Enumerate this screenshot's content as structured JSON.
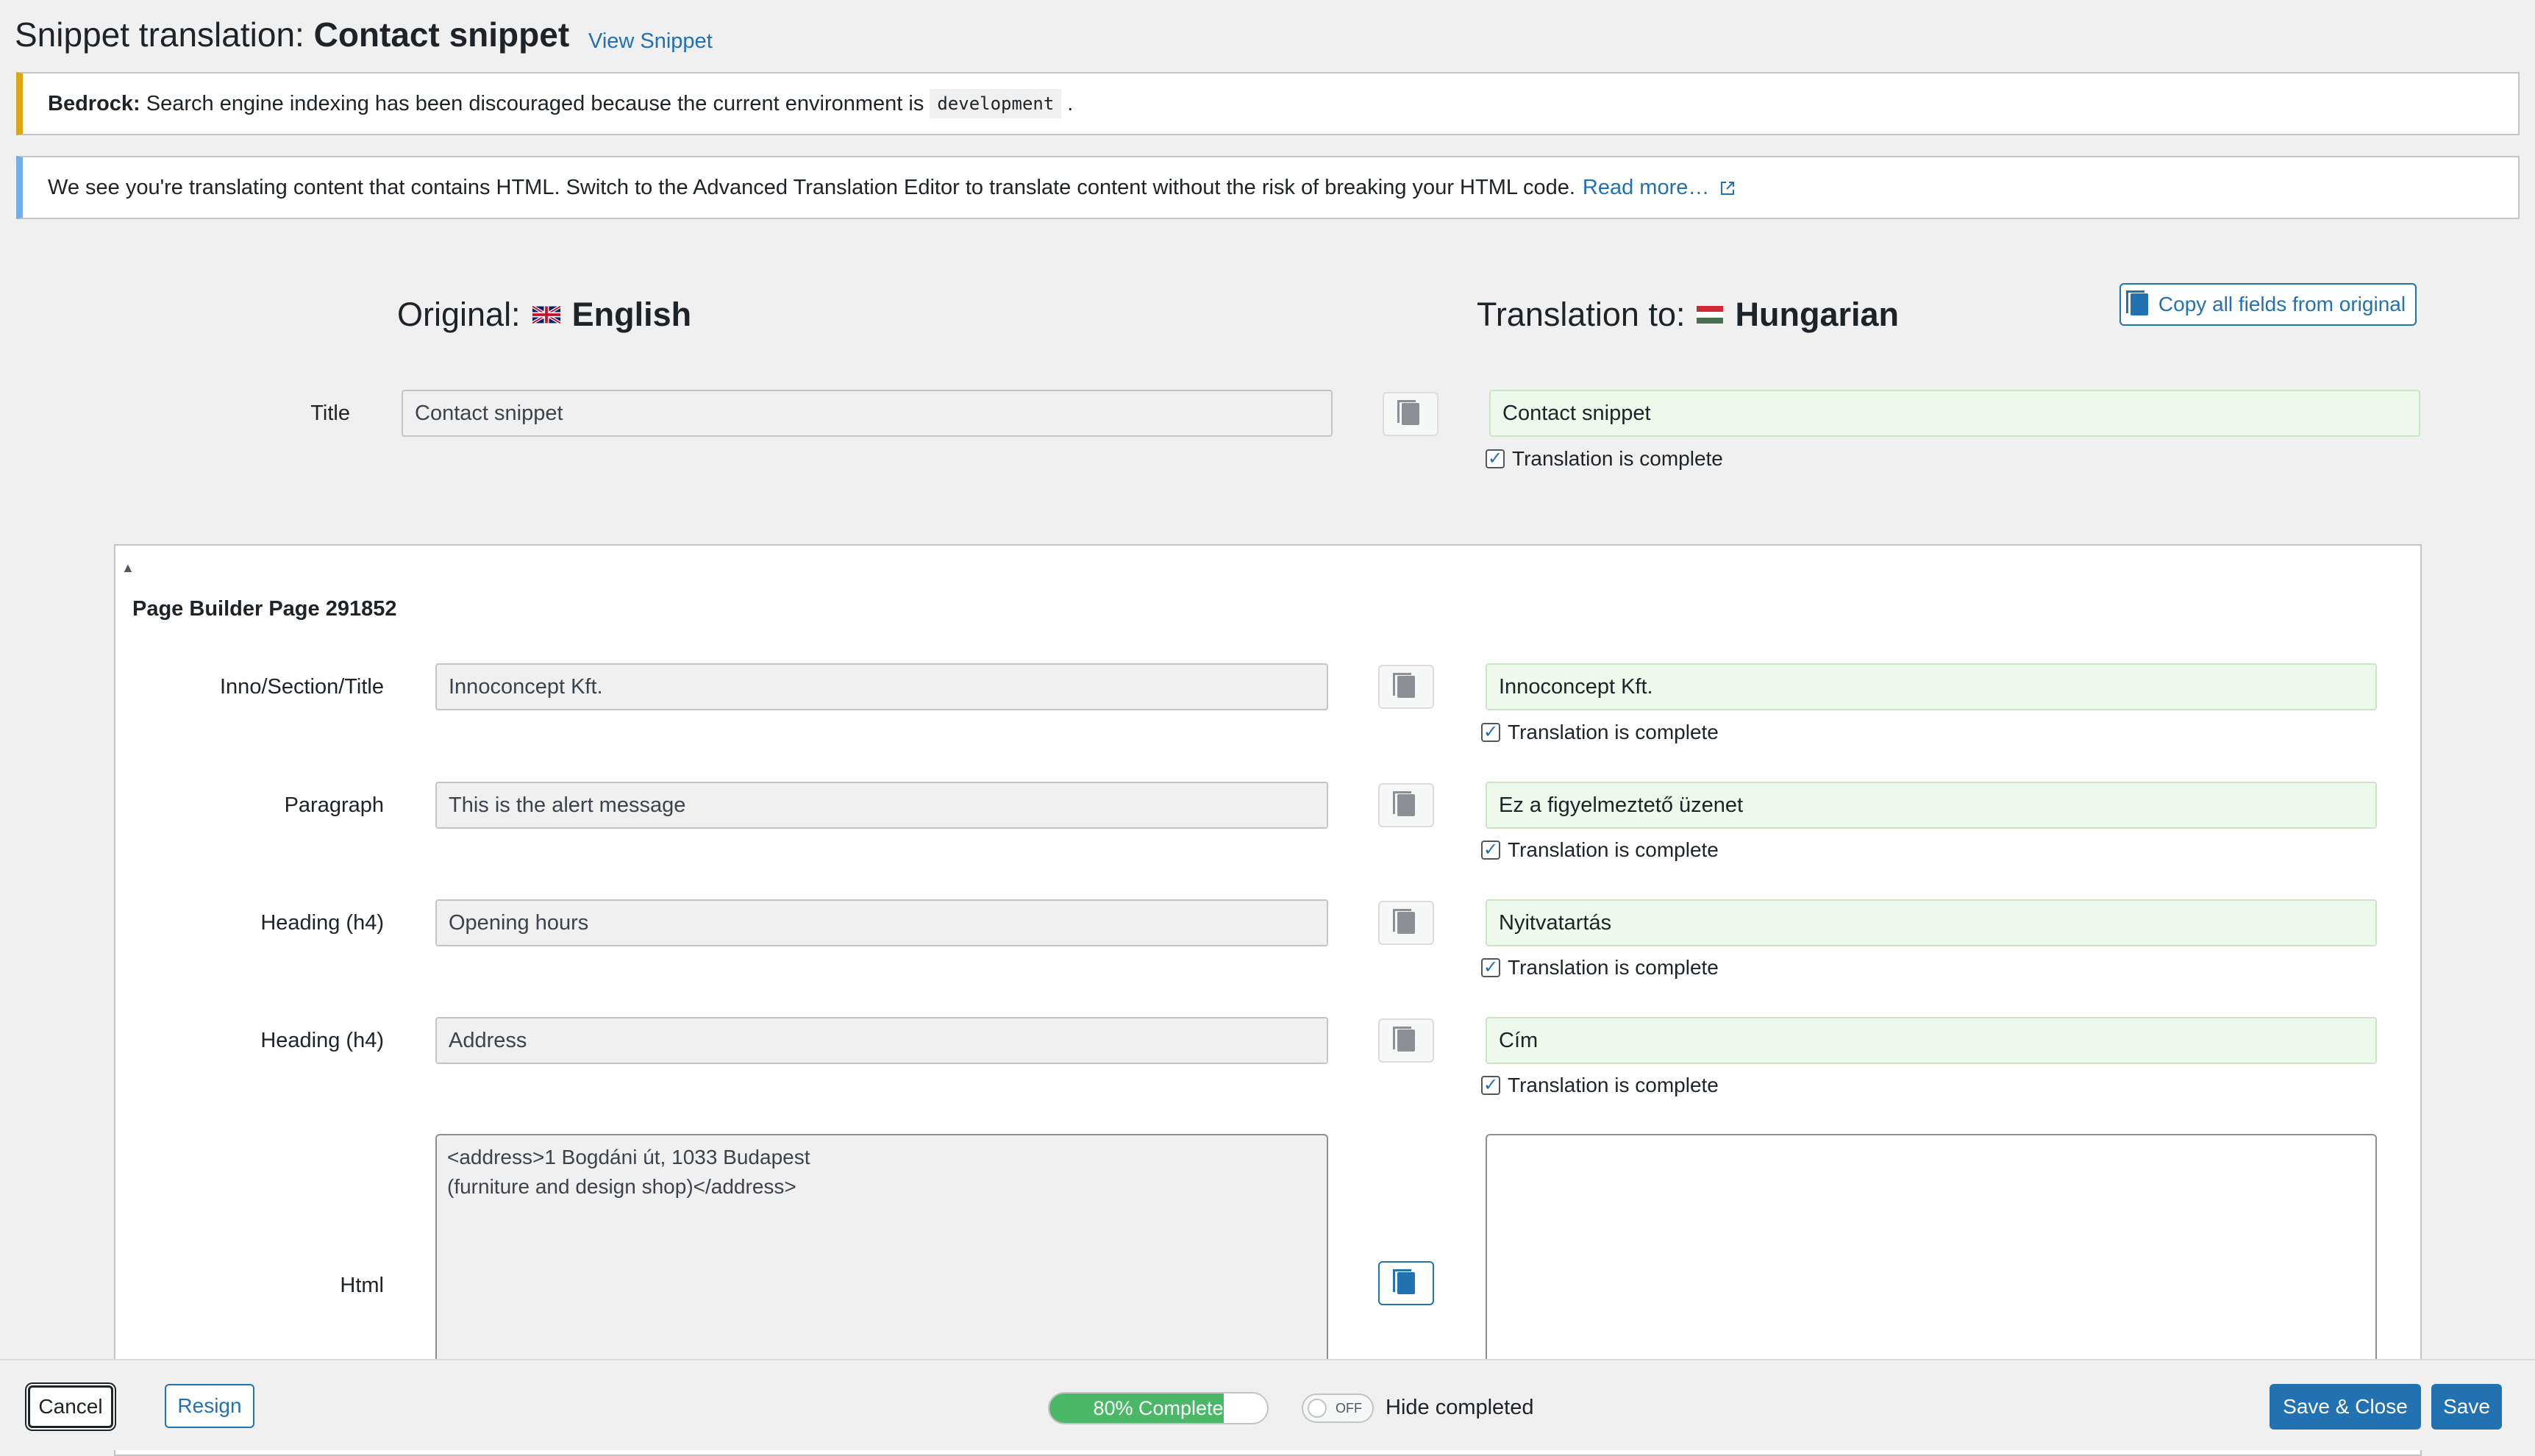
{
  "header": {
    "title_prefix": "Snippet translation: ",
    "title_name": "Contact snippet",
    "view_link": "View Snippet"
  },
  "notices": {
    "bedrock_label": "Bedrock:",
    "bedrock_text": " Search engine indexing has been discouraged because the current environment is",
    "bedrock_code": "development",
    "bedrock_end": ".",
    "html_text": "We see you're translating content that contains HTML. Switch to the Advanced Translation Editor to translate content without the risk of breaking your HTML code.",
    "html_link": "Read more…"
  },
  "columns": {
    "original_label": "Original:",
    "original_lang": "English",
    "translation_label": "Translation to:",
    "translation_lang": "Hungarian",
    "copy_all": "Copy all fields from original"
  },
  "title_field": {
    "label": "Title",
    "original": "Contact snippet",
    "translation": "Contact snippet",
    "complete_label": "Translation is complete"
  },
  "panel": {
    "toggle": "▲",
    "title": "Page Builder Page 291852",
    "fields": [
      {
        "label": "Inno/Section/Title",
        "original": "Innoconcept Kft.",
        "translation": "Innoconcept Kft.",
        "complete_label": "Translation is complete"
      },
      {
        "label": "Paragraph",
        "original": "This is the alert message",
        "translation": "Ez a figyelmeztető üzenet",
        "complete_label": "Translation is complete"
      },
      {
        "label": "Heading (h4)",
        "original": "Opening hours",
        "translation": "Nyitvatartás",
        "complete_label": "Translation is complete"
      },
      {
        "label": "Heading (h4)",
        "original": "Address",
        "translation": "Cím",
        "complete_label": "Translation is complete"
      }
    ],
    "html_field": {
      "label": "Html",
      "original_line1": "<address>1 Bogdáni út, 1033 Budapest",
      "original_line2": "(furniture and design shop)</address>",
      "translation": ""
    }
  },
  "footer": {
    "cancel": "Cancel",
    "resign": "Resign",
    "progress_text": "80% Complete",
    "progress_value": 0.8,
    "toggle_state": "OFF",
    "hide_completed": "Hide completed",
    "save_close": "Save & Close",
    "save": "Save"
  },
  "colors": {
    "accent": "#2271b1",
    "warning": "#dba617",
    "info": "#72aee6",
    "translated_bg": "#edfaeb",
    "progress": "#4ab866"
  }
}
